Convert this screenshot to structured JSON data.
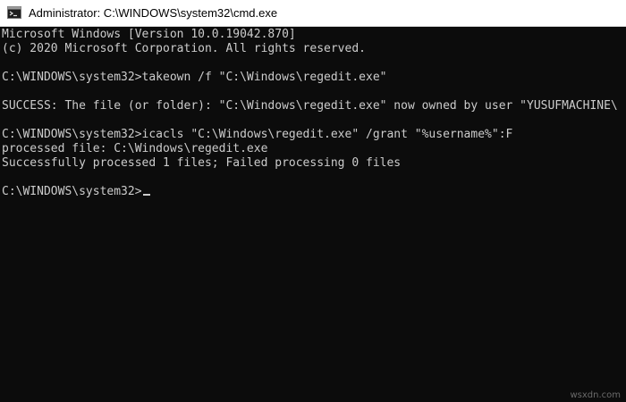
{
  "window": {
    "title": "Administrator: C:\\WINDOWS\\system32\\cmd.exe",
    "icon": "cmd-icon"
  },
  "console": {
    "lines": [
      "Microsoft Windows [Version 10.0.19042.870]",
      "(c) 2020 Microsoft Corporation. All rights reserved.",
      "",
      "C:\\WINDOWS\\system32>takeown /f \"C:\\Windows\\regedit.exe\"",
      "",
      "SUCCESS: The file (or folder): \"C:\\Windows\\regedit.exe\" now owned by user \"YUSUFMACHINE\\",
      "",
      "C:\\WINDOWS\\system32>icacls \"C:\\Windows\\regedit.exe\" /grant \"%username%\":F",
      "processed file: C:\\Windows\\regedit.exe",
      "Successfully processed 1 files; Failed processing 0 files",
      ""
    ],
    "prompt": "C:\\WINDOWS\\system32>"
  },
  "watermark": "wsxdn.com",
  "colors": {
    "background": "#0c0c0c",
    "text": "#cccccc",
    "titlebar": "#ffffff"
  }
}
